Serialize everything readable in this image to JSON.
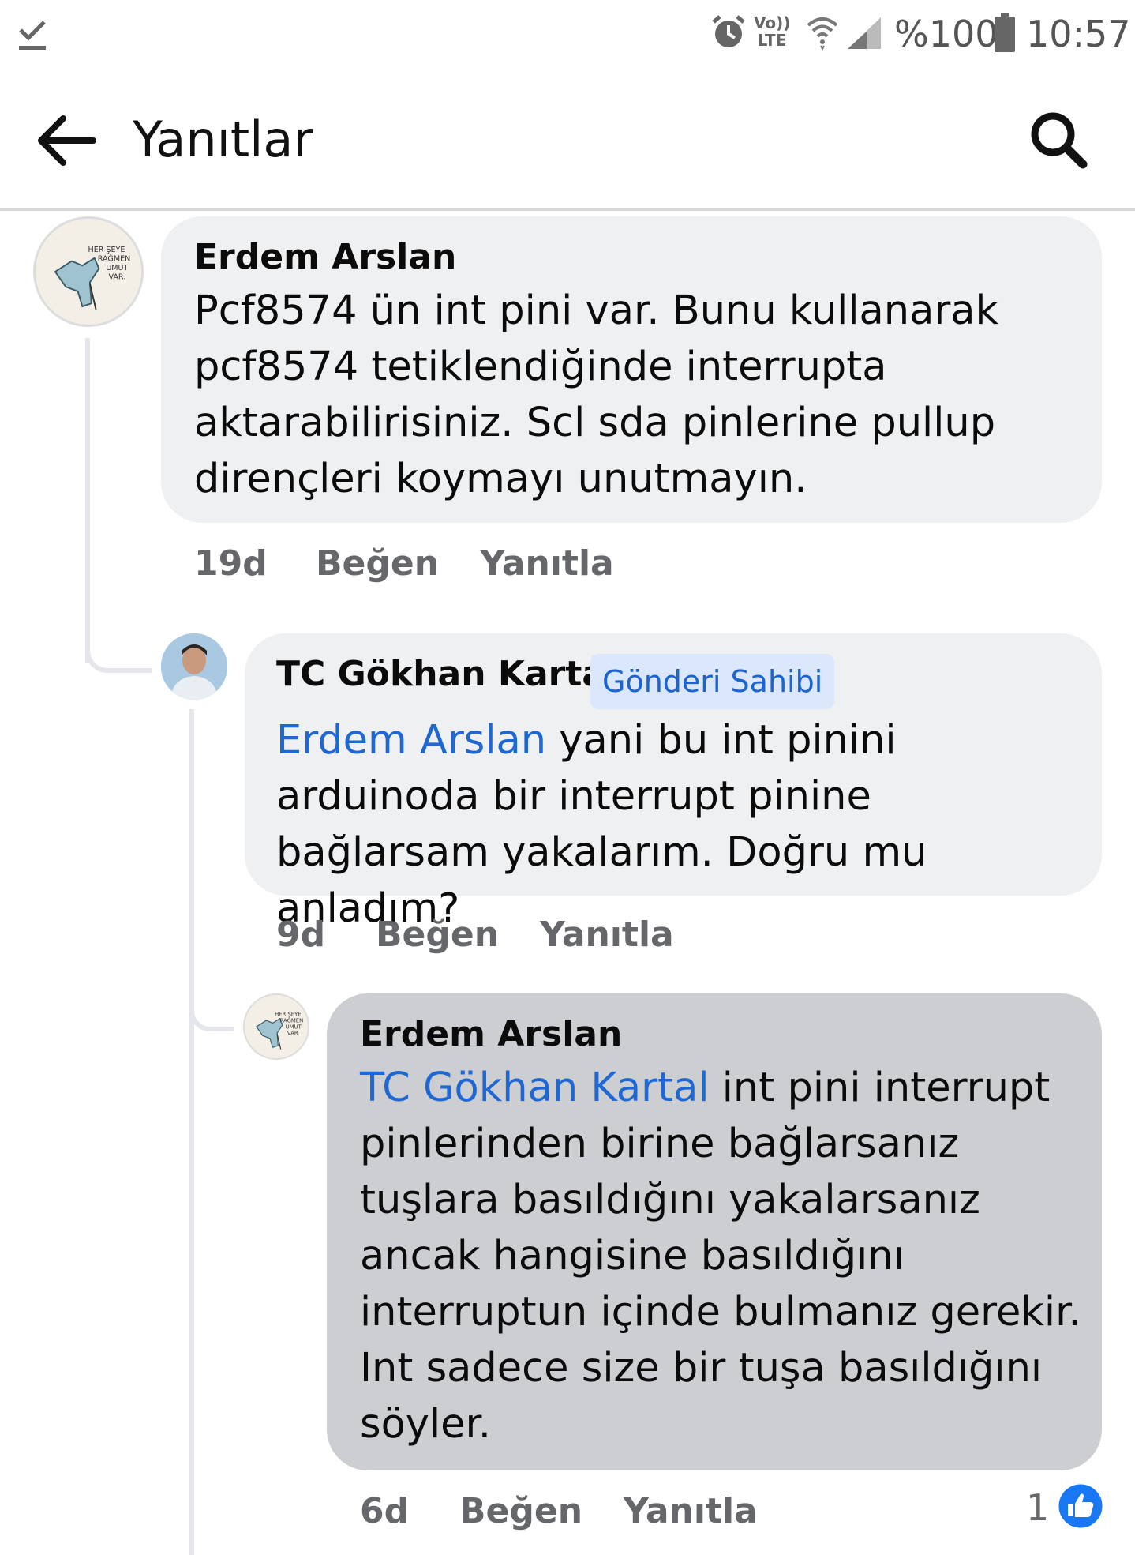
{
  "status_bar": {
    "signal_label": "Vo)) LTE",
    "battery_percent": "%100",
    "time": "10:57"
  },
  "header": {
    "title": "Yanıtlar"
  },
  "comments": [
    {
      "author": "Erdem Arslan",
      "text": "Pcf8574 ün int pini var. Bunu kullanarak pcf8574 tetiklendiğinde interrupta aktarabilirisiniz. Scl sda pinlerine pullup dirençleri koymayı unutmayın.",
      "time": "19d",
      "like": "Beğen",
      "reply": "Yanıtla"
    },
    {
      "author": "TC Gökhan Kartal",
      "badge": "Gönderi Sahibi",
      "mention": "Erdem Arslan",
      "text": " yani bu int pinini arduinoda bir interrupt pinine bağlarsam yakalarım. Doğru mu anladım?",
      "time": "9d",
      "like": "Beğen",
      "reply": "Yanıtla"
    },
    {
      "author": "Erdem Arslan",
      "mention": "TC Gökhan Kartal",
      "text": " int pini interrupt pinlerinden birine bağlarsanız tuşlara basıldığını yakalarsanız ancak hangisine basıldığını interruptun içinde bulmanız gerekir. Int sadece size bir tuşa basıldığını söyler.",
      "time": "6d",
      "like": "Beğen",
      "reply": "Yanıtla",
      "reaction_count": "1"
    }
  ],
  "avatar_text": [
    "HER ŞEYE",
    "RAĞMEN",
    "UMUT",
    "VAR."
  ],
  "colors": {
    "mention": "#1f67d2",
    "bubble": "#eff0f2",
    "bubble_highlighted": "#ccced2",
    "like_blue": "#1877f2"
  }
}
